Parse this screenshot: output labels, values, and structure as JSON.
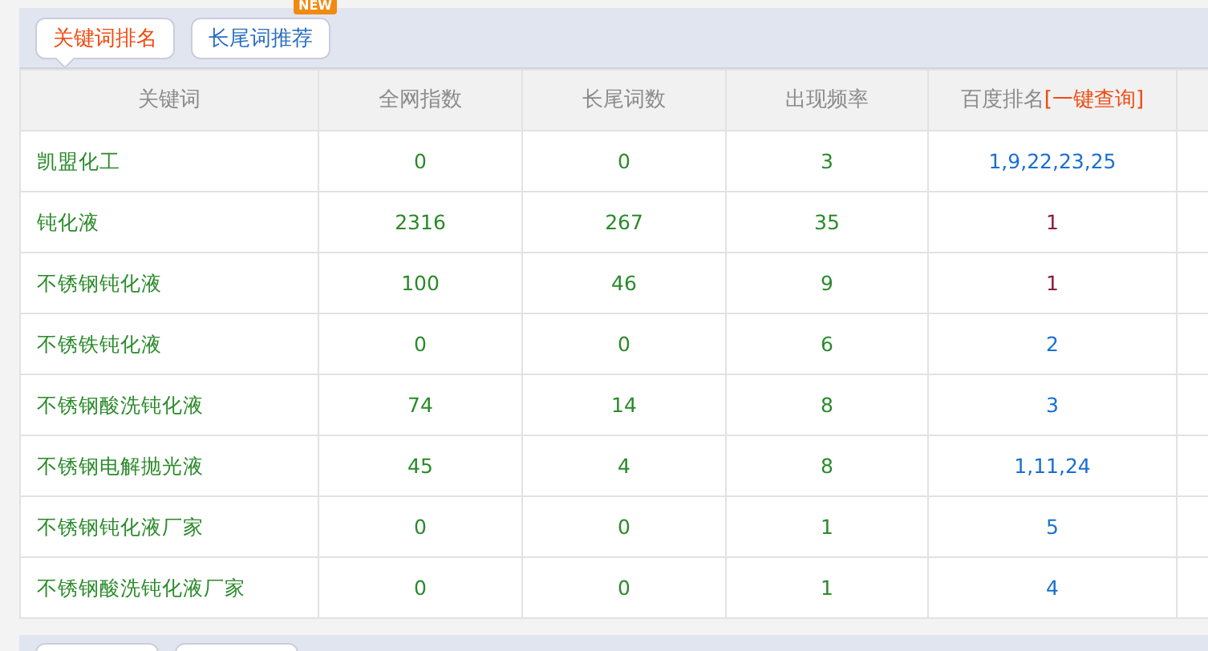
{
  "tabs": [
    {
      "label": "关键词排名",
      "selected": true
    },
    {
      "label": "长尾词推荐",
      "selected": false,
      "badge": "NEW"
    }
  ],
  "table": {
    "columns": [
      {
        "label": "关键词"
      },
      {
        "label": "全网指数"
      },
      {
        "label": "长尾词数"
      },
      {
        "label": "出现频率"
      },
      {
        "label": "百度排名",
        "link": "[一键查询]"
      }
    ],
    "rows": [
      {
        "keyword": "凯盟化工",
        "index": "0",
        "longtail": "0",
        "frequency": "3",
        "rank": "1,9,22,23,25",
        "color": "#1a6fd0"
      },
      {
        "keyword": "钝化液",
        "index": "2316",
        "longtail": "267",
        "frequency": "35",
        "rank": "1",
        "color": "#8b1a3a"
      },
      {
        "keyword": "不锈钢钝化液",
        "index": "100",
        "longtail": "46",
        "frequency": "9",
        "rank": "1",
        "color": "#8b1a3a"
      },
      {
        "keyword": "不锈铁钝化液",
        "index": "0",
        "longtail": "0",
        "frequency": "6",
        "rank": "2",
        "color": "#1a6fd0"
      },
      {
        "keyword": "不锈钢酸洗钝化液",
        "index": "74",
        "longtail": "14",
        "frequency": "8",
        "rank": "3",
        "color": "#1a6fd0"
      },
      {
        "keyword": "不锈钢电解抛光液",
        "index": "45",
        "longtail": "4",
        "frequency": "8",
        "rank": "1,11,24",
        "color": "#1a6fd0"
      },
      {
        "keyword": "不锈钢钝化液厂家",
        "index": "0",
        "longtail": "0",
        "frequency": "1",
        "rank": "5",
        "color": "#1a6fd0"
      },
      {
        "keyword": "不锈钢酸洗钝化液厂家",
        "index": "0",
        "longtail": "0",
        "frequency": "1",
        "rank": "4",
        "color": "#1a6fd0"
      }
    ]
  }
}
